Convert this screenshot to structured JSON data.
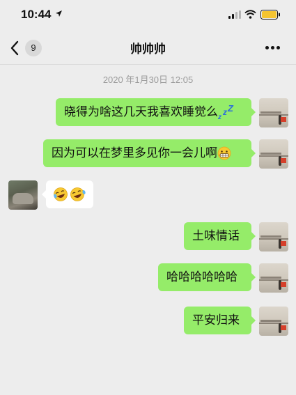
{
  "status_bar": {
    "time": "10:44"
  },
  "header": {
    "title": "帅帅帅",
    "back_badge": "9"
  },
  "timestamp": "2020 年1月30日 12:05",
  "messages": [
    {
      "from": "me",
      "text": "晓得为啥这几天我喜欢睡觉么",
      "emoji": "zzz"
    },
    {
      "from": "me",
      "text": "因为可以在梦里多见你一会儿啊",
      "emoji": "grin-face"
    },
    {
      "from": "other",
      "text": "",
      "emoji": "crying-laughing-face-x2"
    },
    {
      "from": "me",
      "text": "土味情话"
    },
    {
      "from": "me",
      "text": "哈哈哈哈哈哈"
    },
    {
      "from": "me",
      "text": "平安归来"
    }
  ],
  "colors": {
    "bubble_out": "#95ec69",
    "bubble_in": "#ffffff",
    "background": "#ededed"
  }
}
